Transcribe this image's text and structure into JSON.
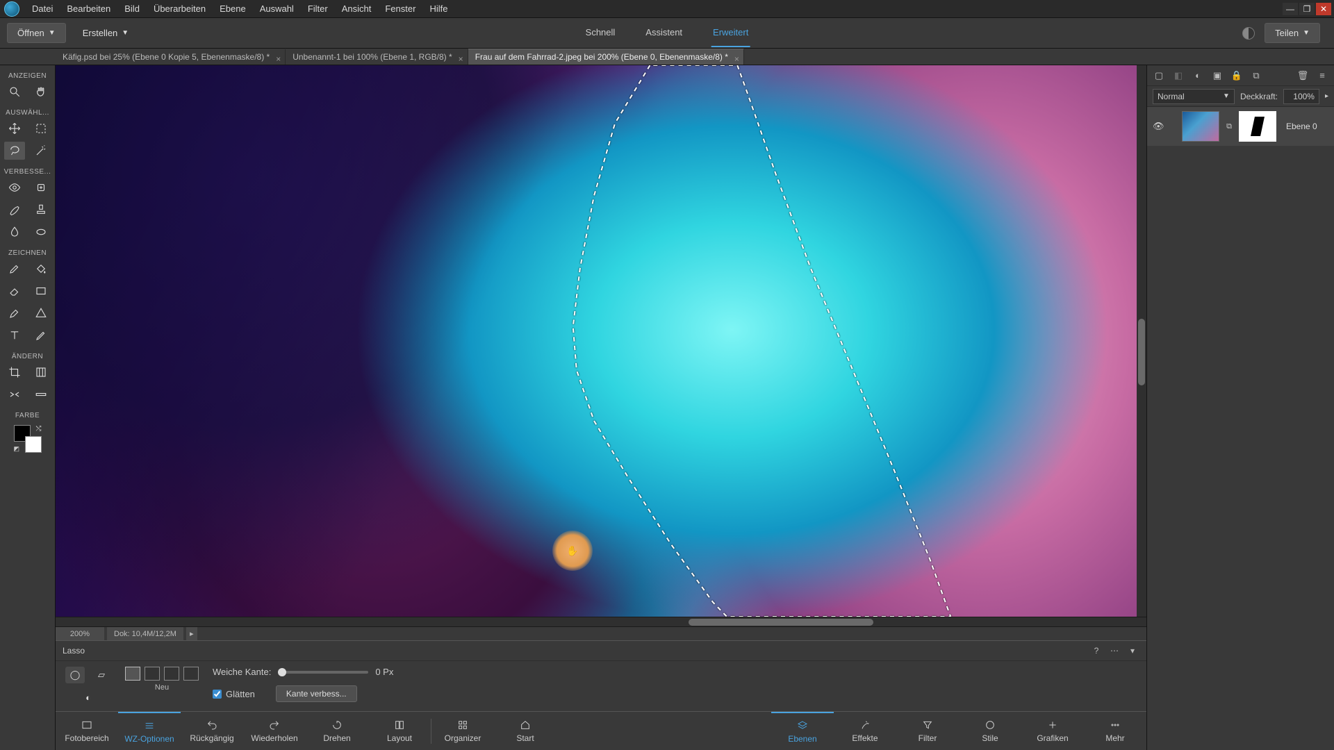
{
  "menu": [
    "Datei",
    "Bearbeiten",
    "Bild",
    "Überarbeiten",
    "Ebene",
    "Auswahl",
    "Filter",
    "Ansicht",
    "Fenster",
    "Hilfe"
  ],
  "sub_bar": {
    "open": "Öffnen",
    "create": "Erstellen",
    "modes": {
      "quick": "Schnell",
      "guided": "Assistent",
      "expert": "Erweitert"
    },
    "share": "Teilen"
  },
  "doc_tabs": [
    "Käfig.psd bei 25% (Ebene 0 Kopie 5, Ebenenmaske/8) *",
    "Unbenannt-1 bei 100% (Ebene 1, RGB/8) *",
    "Frau auf dem Fahrrad-2.jpeg bei 200% (Ebene 0, Ebenenmaske/8) *"
  ],
  "doc_active": 2,
  "left_labels": {
    "view": "ANZEIGEN",
    "select": "AUSWÄHL...",
    "enhance": "VERBESSE...",
    "draw": "ZEICHNEN",
    "modify": "ÄNDERN",
    "color": "FARBE"
  },
  "status": {
    "zoom": "200%",
    "doc": "Dok: 10,4M/12,2M"
  },
  "options": {
    "tool": "Lasso",
    "new_label": "Neu",
    "feather_label": "Weiche Kante:",
    "feather_value": "0 Px",
    "antialias": "Glätten",
    "refine": "Kante verbess..."
  },
  "bottom": {
    "left": [
      "Fotobereich",
      "WZ-Optionen",
      "Rückgängig",
      "Wiederholen",
      "Drehen",
      "Layout"
    ],
    "left_active": 1,
    "mid": [
      "Organizer",
      "Start"
    ],
    "right": [
      "Ebenen",
      "Effekte",
      "Filter",
      "Stile",
      "Grafiken",
      "Mehr"
    ],
    "right_active": 0
  },
  "right_panel": {
    "blend_mode": "Normal",
    "opacity_label": "Deckkraft:",
    "opacity_value": "100%",
    "layer_name": "Ebene 0"
  }
}
